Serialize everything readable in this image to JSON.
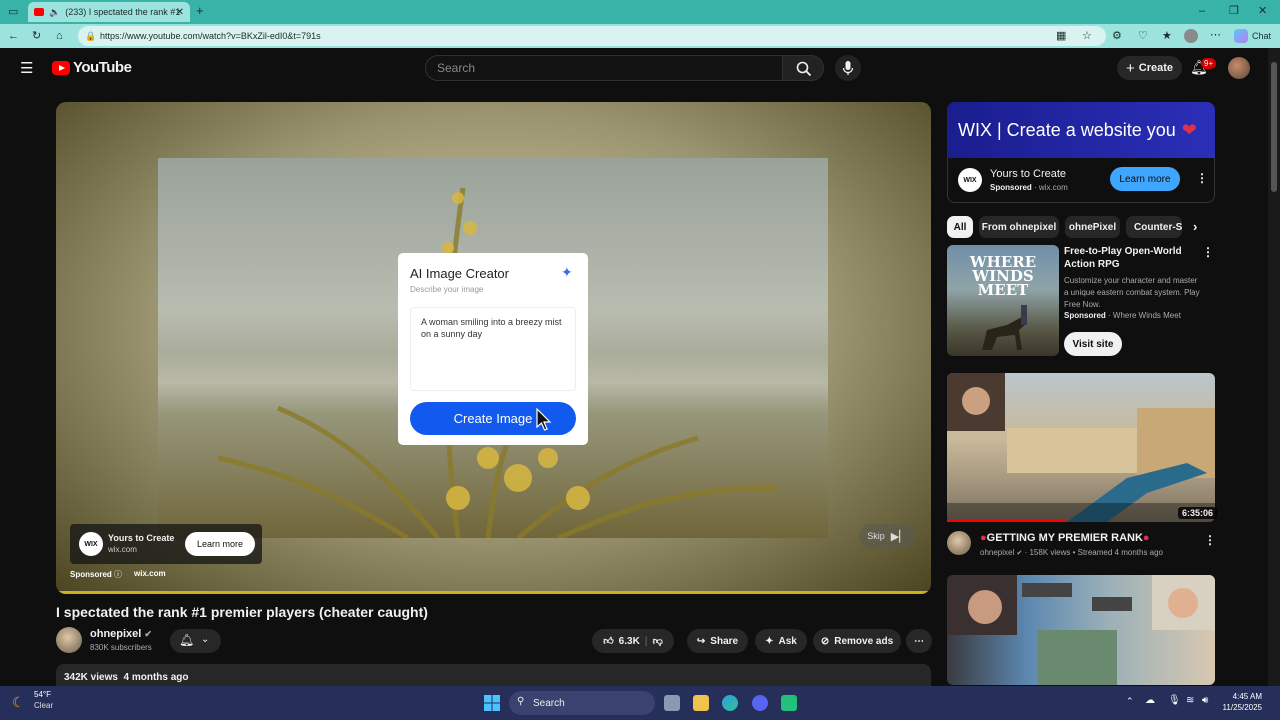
{
  "browser": {
    "tab_title": "(233) I spectated the rank #1",
    "url": "https://www.youtube.com/watch?v=BKxZil-edI0&t=791s",
    "chat_label": "Chat"
  },
  "header": {
    "logo_text": "YouTube",
    "search_placeholder": "Search",
    "create_label": "Create",
    "notification_count": "9+"
  },
  "player": {
    "overlay": {
      "title": "AI Image Creator",
      "subtitle": "Describe your image",
      "prompt_text": "A woman smiling into a breezy mist on a sunny day",
      "button_label": "Create Image"
    },
    "ad": {
      "logo_text": "WIX",
      "advertiser": "Yours to Create",
      "domain": "wix.com",
      "learn_more": "Learn more",
      "sponsored_label": "Sponsored",
      "sponsored_domain": "wix.com",
      "skip_label": "Skip"
    },
    "progress_fraction": 1.0,
    "accent_color": "#c9b21c"
  },
  "video": {
    "title": "I spectated the rank #1 premier players (cheater caught)",
    "channel": "ohnepixel",
    "subscribers": "830K subscribers",
    "likes": "6.3K",
    "share_label": "Share",
    "ask_label": "Ask",
    "remove_ads_label": "Remove ads",
    "views": "342K views",
    "age": "4 months ago"
  },
  "sidebar_ad": {
    "banner_text": "WIX | Create a website you",
    "logo_text": "WIX",
    "name": "Yours to Create",
    "sponsored_label": "Sponsored",
    "domain": "wix.com",
    "learn_more": "Learn more"
  },
  "chips": [
    "All",
    "From ohnepixel",
    "ohnePixel",
    "Counter-St"
  ],
  "promoted": {
    "thumb_text_line1": "WHERE",
    "thumb_text_line2": "WINDS MEET",
    "title": "Free-to-Play Open-World Action RPG",
    "description": "Customize your character and master a unique eastern combat system. Play Free Now.",
    "sponsored_label": "Sponsored",
    "advertiser": "Where Winds Meet",
    "cta": "Visit site"
  },
  "recommendations": [
    {
      "title": "GETTING MY PREMIER RANK",
      "channel": "ohnepixel",
      "meta": "158K views • Streamed 4 months ago",
      "duration": "6:35:06",
      "watched_fraction": 0.44
    }
  ],
  "taskbar": {
    "temperature": "54°F",
    "condition": "Clear",
    "search_label": "Search",
    "time": "4:45 AM",
    "date": "11/25/2025"
  }
}
